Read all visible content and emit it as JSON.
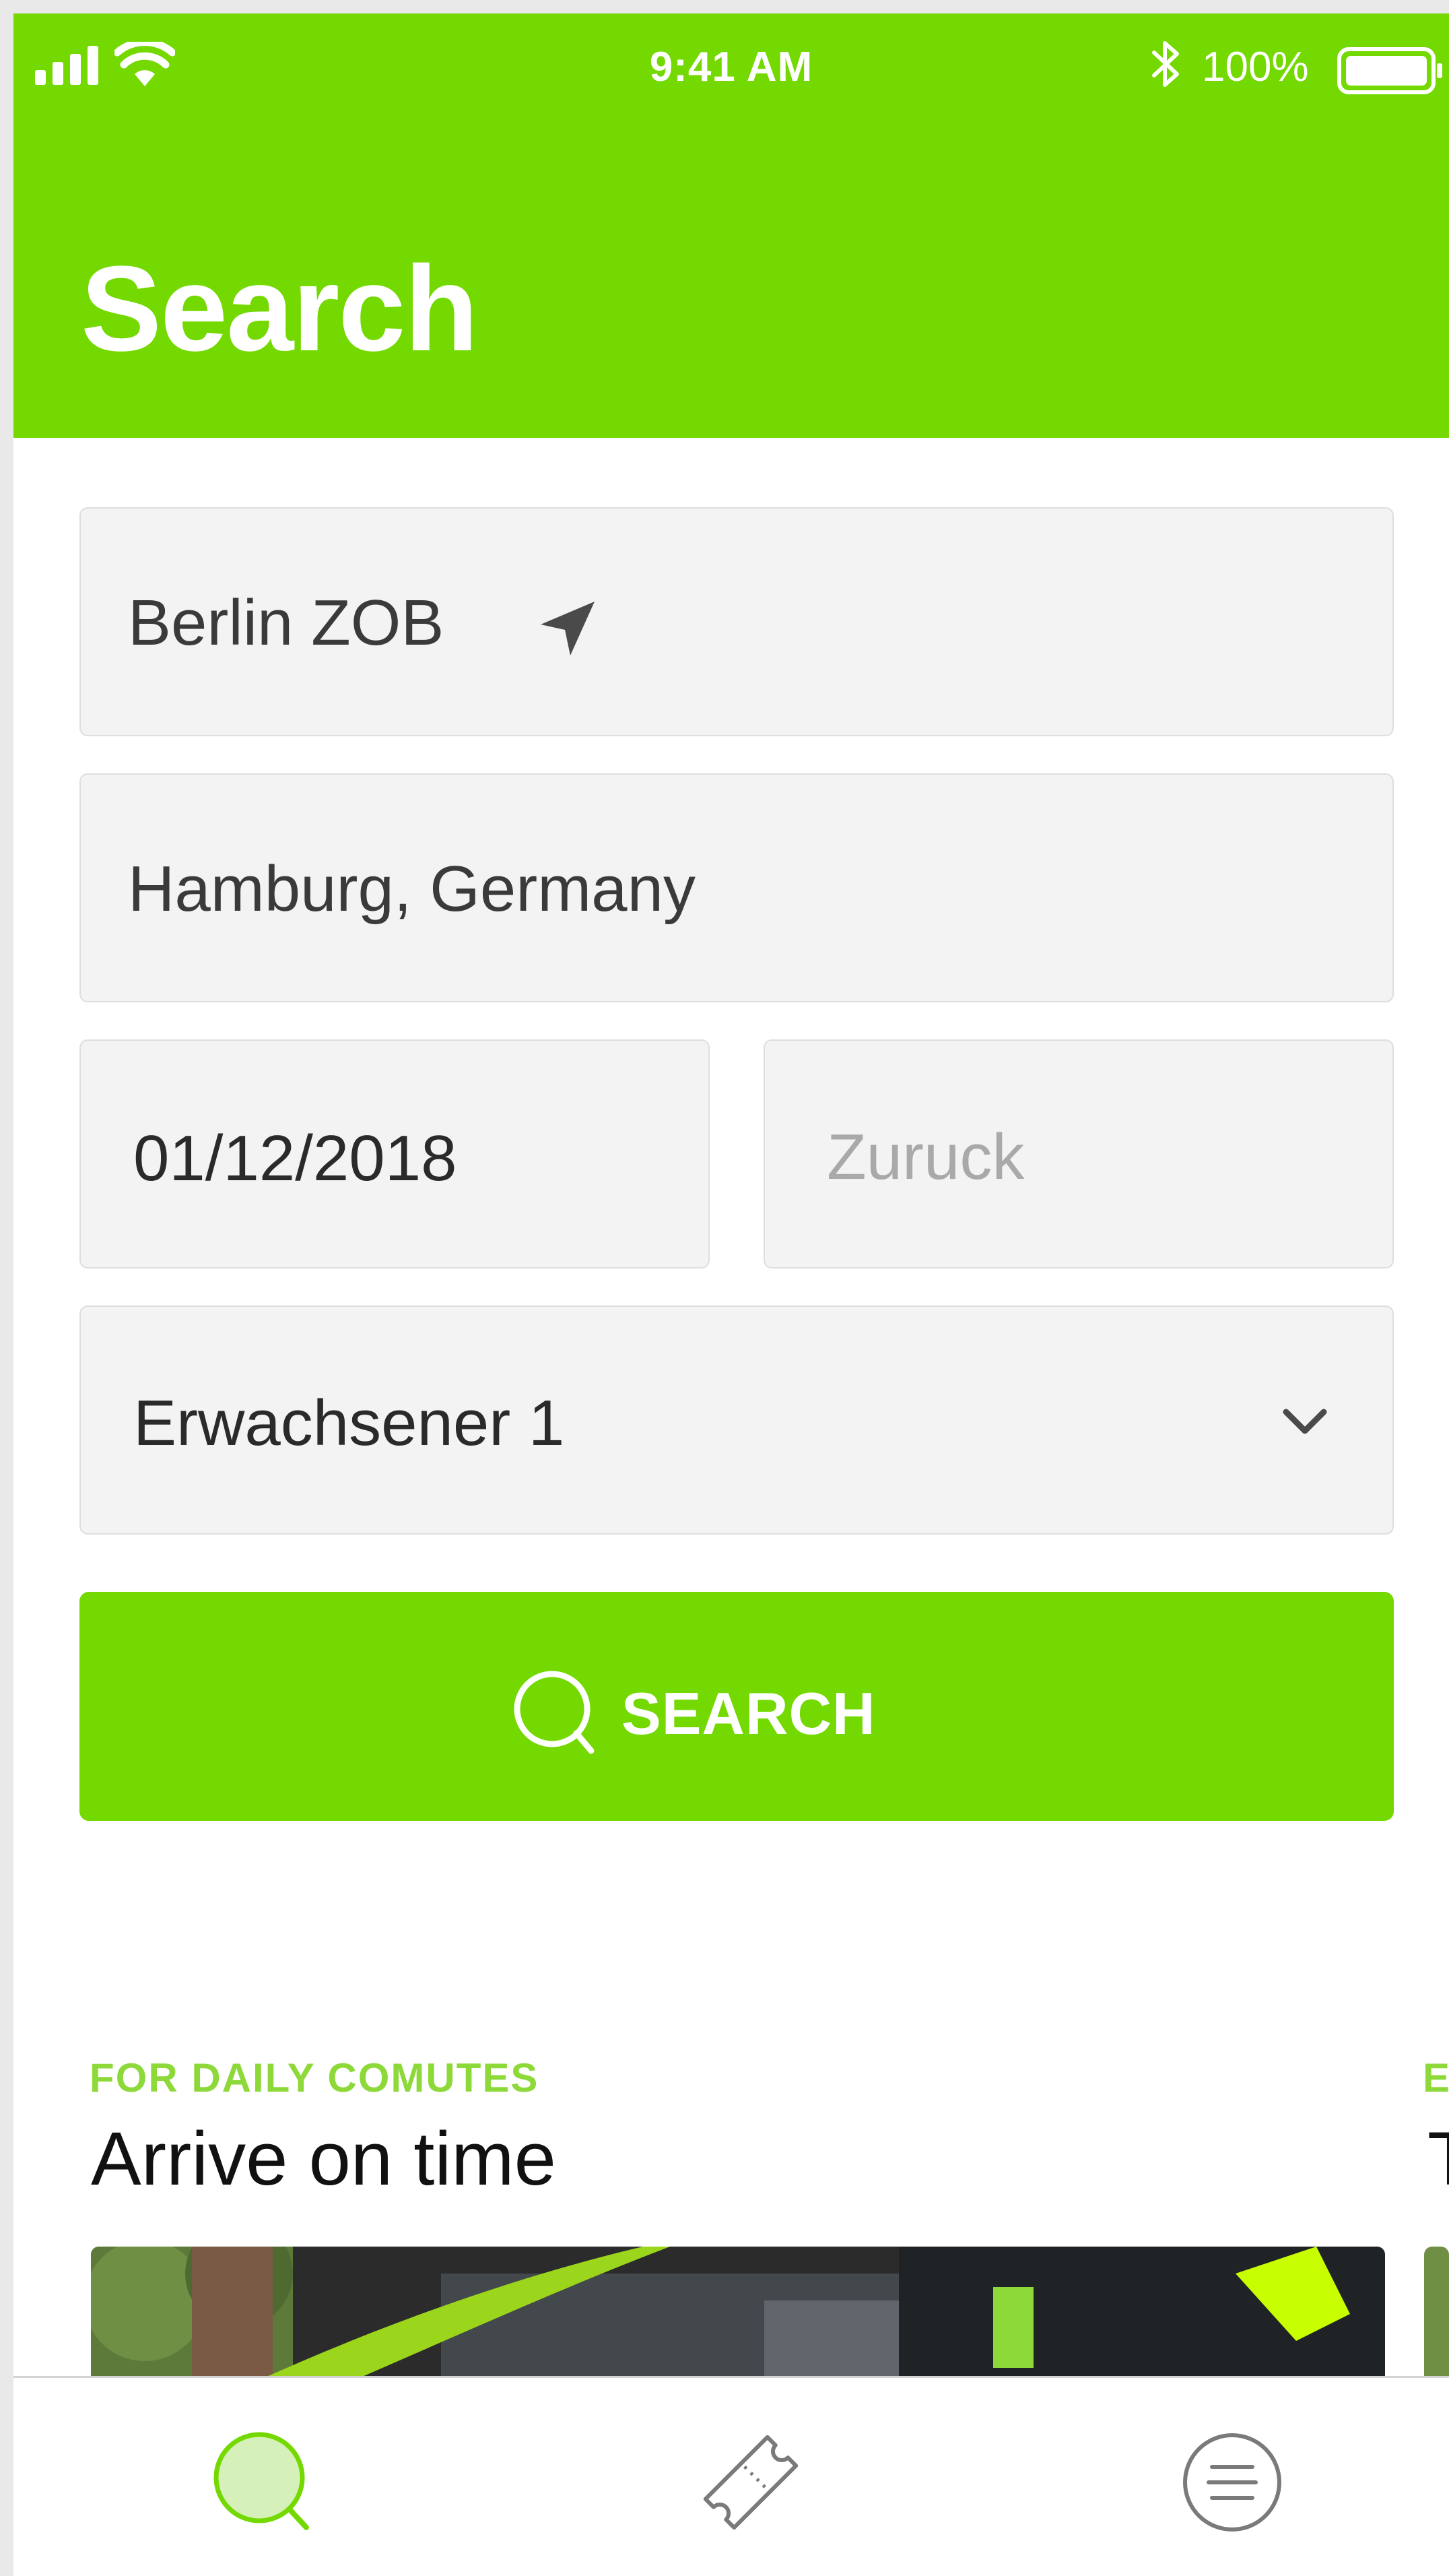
{
  "status_bar": {
    "time": "9:41 AM",
    "battery": "100%",
    "icons": [
      "signal-icon",
      "wifi-icon",
      "bluetooth-icon",
      "battery-icon"
    ]
  },
  "header": {
    "title": "Search"
  },
  "form": {
    "from": {
      "value": "Berlin ZOB",
      "icon": "location-arrow-icon"
    },
    "to": {
      "value": "Hamburg, Germany"
    },
    "departure_date": {
      "value": "01/12/2018"
    },
    "return_date": {
      "placeholder": "Zuruck"
    },
    "passengers": {
      "value": "Erwachsener 1",
      "icon": "chevron-down-icon"
    },
    "search_button": {
      "label": "SEARCH",
      "icon": "search-icon"
    }
  },
  "cards": [
    {
      "eyebrow": "FOR DAILY COMUTES",
      "title": "Arrive on time"
    },
    {
      "eyebrow": "E",
      "title": "T"
    }
  ],
  "tab_bar": {
    "tabs": [
      {
        "name": "search",
        "icon": "search-icon",
        "active": true
      },
      {
        "name": "tickets",
        "icon": "ticket-icon",
        "active": false
      },
      {
        "name": "menu",
        "icon": "menu-icon",
        "active": false
      }
    ]
  },
  "colors": {
    "accent": "#73d900",
    "eyebrow": "#8ed93a",
    "field_bg": "#f3f3f3",
    "placeholder": "#a9a9a9"
  }
}
